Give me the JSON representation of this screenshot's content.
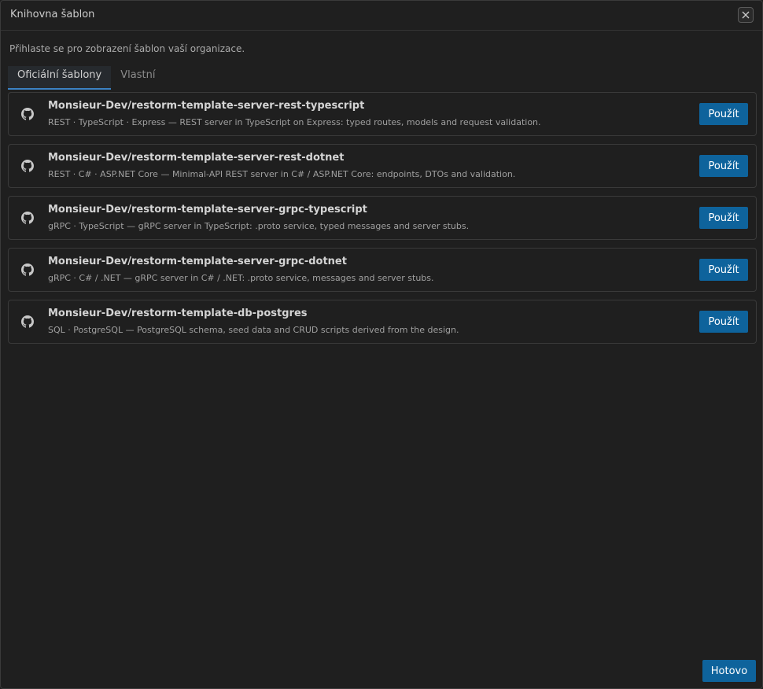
{
  "dialog": {
    "title": "Knihovna šablon",
    "subtitle": "Přihlaste se pro zobrazení šablon vaší organizace.",
    "close_icon": "close-icon"
  },
  "tabs": [
    {
      "label": "Oficiální šablony",
      "active": true
    },
    {
      "label": "Vlastní",
      "active": false
    }
  ],
  "templates": [
    {
      "name": "Monsieur-Dev/restorm-template-server-rest-typescript",
      "description": "REST · TypeScript · Express — REST server in TypeScript on Express: typed routes, models and request validation.",
      "button": "Použít",
      "icon": "github-icon"
    },
    {
      "name": "Monsieur-Dev/restorm-template-server-rest-dotnet",
      "description": "REST · C# · ASP.NET Core — Minimal-API REST server in C# / ASP.NET Core: endpoints, DTOs and validation.",
      "button": "Použít",
      "icon": "github-icon"
    },
    {
      "name": "Monsieur-Dev/restorm-template-server-grpc-typescript",
      "description": "gRPC · TypeScript — gRPC server in TypeScript: .proto service, typed messages and server stubs.",
      "button": "Použít",
      "icon": "github-icon"
    },
    {
      "name": "Monsieur-Dev/restorm-template-server-grpc-dotnet",
      "description": "gRPC · C# / .NET — gRPC server in C# / .NET: .proto service, messages and server stubs.",
      "button": "Použít",
      "icon": "github-icon"
    },
    {
      "name": "Monsieur-Dev/restorm-template-db-postgres",
      "description": "SQL · PostgreSQL — PostgreSQL schema, seed data and CRUD scripts derived from the design.",
      "button": "Použít",
      "icon": "github-icon"
    }
  ],
  "footer": {
    "done_label": "Hotovo"
  },
  "colors": {
    "accent": "#0e639c",
    "background": "#1f1f1f",
    "border": "#3a3a3a",
    "tab_underline": "#3b82c4"
  }
}
